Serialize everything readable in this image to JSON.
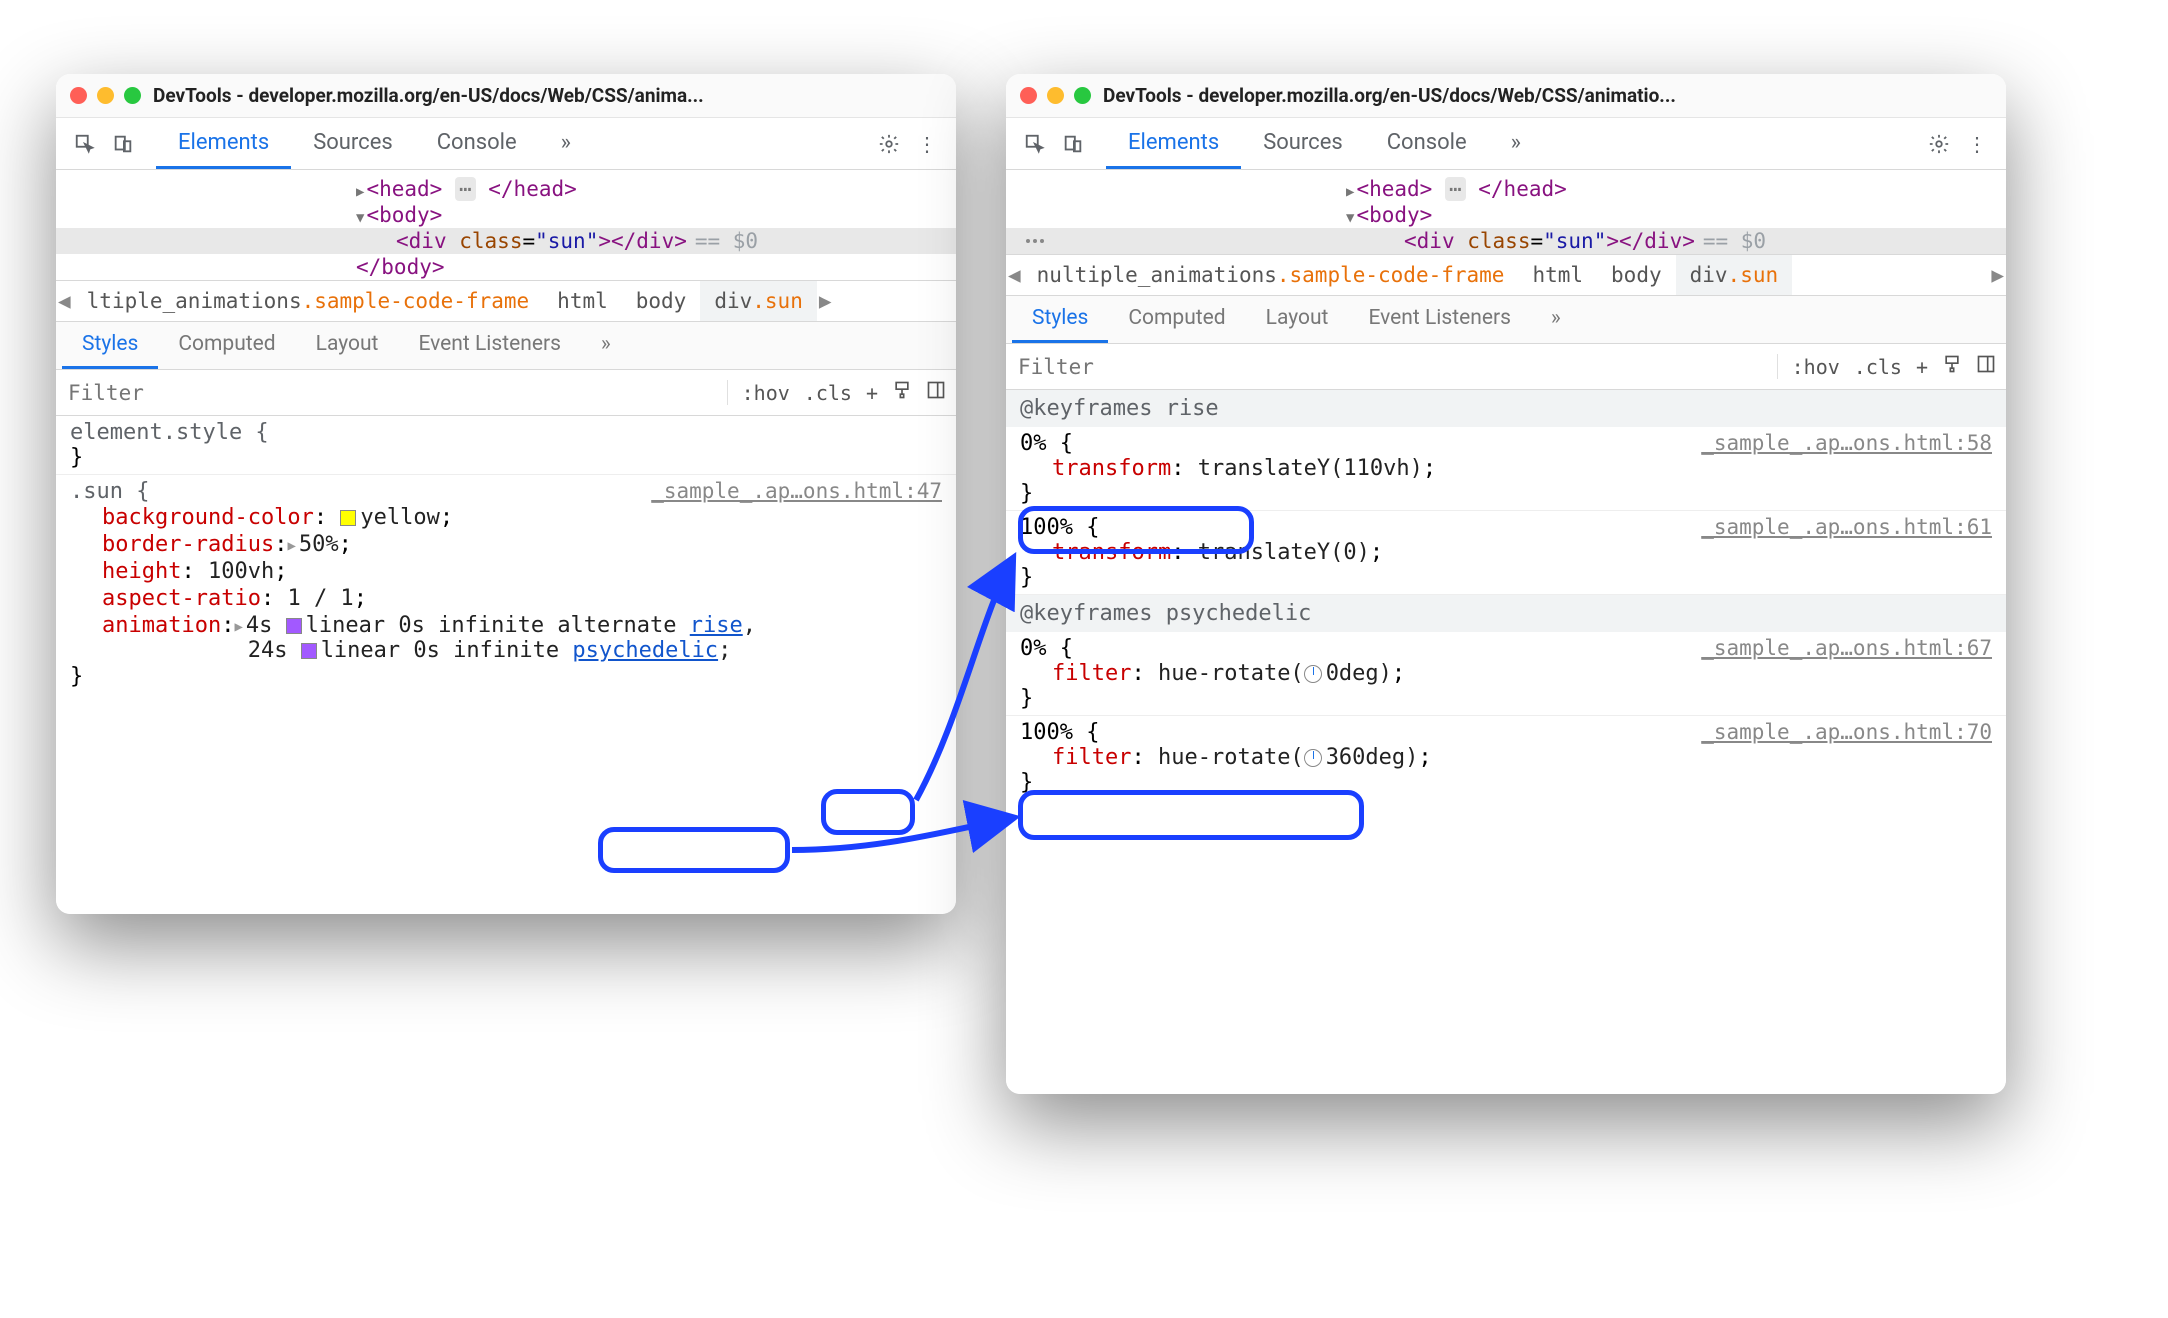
{
  "window_title_left": "DevTools - developer.mozilla.org/en-US/docs/Web/CSS/anima...",
  "window_title_right": "DevTools - developer.mozilla.org/en-US/docs/Web/CSS/animatio...",
  "tabs": {
    "elements": "Elements",
    "sources": "Sources",
    "console": "Console"
  },
  "dom": {
    "head_open": "<head>",
    "head_close": "</head>",
    "body_open": "<body>",
    "body_close": "</body>",
    "div_open_tag": "div",
    "div_attr_name": "class",
    "div_attr_val": "\"sun\"",
    "div_close": "</div>",
    "eq0": "== $0"
  },
  "crumb_left": {
    "frame_pre": "ltiple_animations",
    "frame_class": ".sample-code-frame",
    "html": "html",
    "body": "body",
    "div": "div",
    "div_class": ".sun"
  },
  "crumb_right": {
    "frame_pre": "nultiple_animations",
    "frame_class": ".sample-code-frame",
    "html": "html",
    "body": "body",
    "div": "div",
    "div_class": ".sun"
  },
  "subtabs": {
    "styles": "Styles",
    "computed": "Computed",
    "layout": "Layout",
    "event_listeners": "Event Listeners"
  },
  "filter_placeholder": "Filter",
  "filter_actions": {
    "hov": ":hov",
    "cls": ".cls",
    "plus": "+"
  },
  "element_style": "element.style {",
  "brace_close": "}",
  "sun_rule": {
    "selector": ".sun {",
    "srcloc": "_sample_.ap…ons.html:47",
    "bgc_p": "background-color",
    "bgc_v": "yellow",
    "br_p": "border-radius",
    "br_v": "50%",
    "h_p": "height",
    "h_v": "100vh",
    "ar_p": "aspect-ratio",
    "ar_v": "1 / 1",
    "anim_p": "animation",
    "anim_line1_pre": "4s ",
    "anim_line1_mid": "linear 0s infinite alternate ",
    "anim_line1_link": "rise",
    "anim_line2_pre": "24s ",
    "anim_line2_mid": "linear 0s infinite ",
    "anim_line2_link": "psychedelic"
  },
  "keyframes": {
    "rise_header": "@keyframes rise",
    "psy_header": "@keyframes psychedelic",
    "rise_0_loc": "_sample_.ap…ons.html:58",
    "rise_100_loc": "_sample_.ap…ons.html:61",
    "psy_0_loc": "_sample_.ap…ons.html:67",
    "psy_100_loc": "_sample_.ap…ons.html:70",
    "step0": "0% {",
    "step100": "100% {",
    "transform": "transform",
    "rise_0_v": "translateY(110vh)",
    "rise_100_v": "translateY(0)",
    "filter": "filter",
    "psy_0_v": "hue-rotate(",
    "psy_0_deg": "0deg)",
    "psy_100_v": "hue-rotate(",
    "psy_100_deg": "360deg)"
  }
}
